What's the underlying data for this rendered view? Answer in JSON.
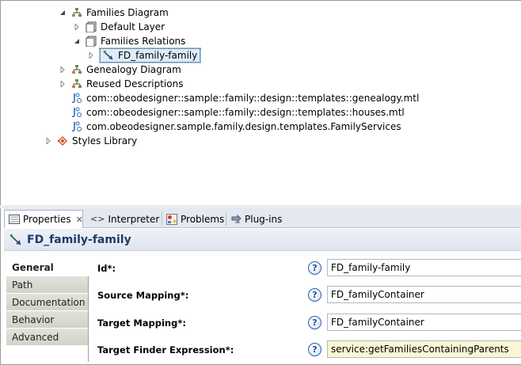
{
  "tree": {
    "items": [
      {
        "label": "Families Diagram",
        "icon": "diagram-description-icon",
        "state": "open"
      },
      {
        "label": "Default Layer",
        "icon": "layer-icon",
        "state": "closed"
      },
      {
        "label": "Families Relations",
        "icon": "layer-icon",
        "state": "open"
      },
      {
        "label": "FD_family-family",
        "icon": "edge-mapping-icon",
        "state": "closed",
        "selected": true
      },
      {
        "label": "Genealogy Diagram",
        "icon": "diagram-description-icon",
        "state": "closed"
      },
      {
        "label": "Reused Descriptions",
        "icon": "diagram-description-icon",
        "state": "closed"
      },
      {
        "label": "com::obeodesigner::sample::family::design::templates::genealogy.mtl",
        "icon": "java-extension-icon",
        "state": "none"
      },
      {
        "label": "com::obeodesigner::sample::family::design::templates::houses.mtl",
        "icon": "java-extension-icon",
        "state": "none"
      },
      {
        "label": "com.obeodesigner.sample.family.design.templates.FamilyServices",
        "icon": "java-extension-icon",
        "state": "none"
      },
      {
        "label": "Styles Library",
        "icon": "styles-library-icon",
        "state": "closed"
      }
    ]
  },
  "tabs": [
    {
      "label": "Properties",
      "icon": "properties-icon",
      "active": true
    },
    {
      "label": "Interpreter",
      "icon": "interpreter-icon"
    },
    {
      "label": "Problems",
      "icon": "problems-icon"
    },
    {
      "label": "Plug-ins",
      "icon": "plugins-icon"
    }
  ],
  "properties": {
    "title": "FD_family-family",
    "side_tabs": [
      "General",
      "Path",
      "Documentation",
      "Behavior",
      "Advanced"
    ],
    "active_side_tab": "General",
    "fields": [
      {
        "label": "Id*:",
        "value": "FD_family-family"
      },
      {
        "label": "Source Mapping*:",
        "value": "FD_familyContainer"
      },
      {
        "label": "Target Mapping*:",
        "value": "FD_familyContainer"
      },
      {
        "label": "Target Finder Expression*:",
        "value": "service:getFamiliesContainingParents",
        "highlight": true
      }
    ],
    "help_symbol": "?"
  },
  "colors": {
    "selection": "#dcecfc",
    "title": "#1f3b6a",
    "expression_bg": "#fbf6d3"
  }
}
